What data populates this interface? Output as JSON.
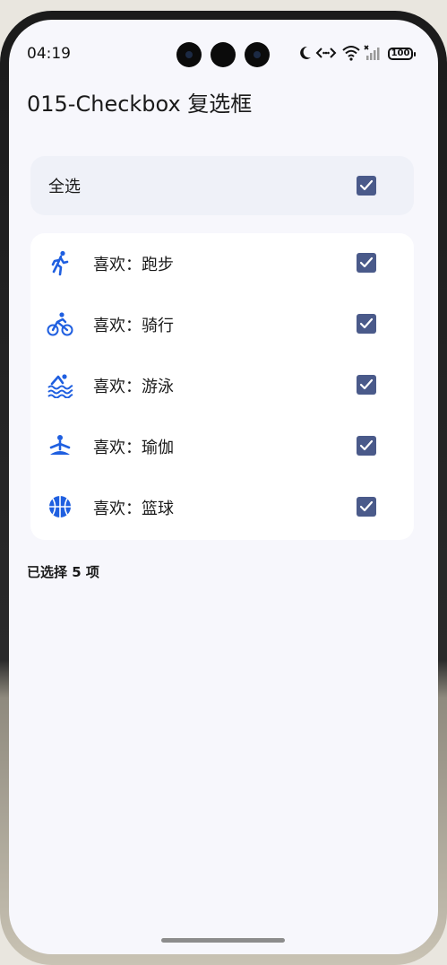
{
  "status_bar": {
    "time": "04:19",
    "battery": "100"
  },
  "page": {
    "title": "015-Checkbox 复选框"
  },
  "select_all": {
    "label": "全选",
    "checked": true
  },
  "items": [
    {
      "label": "喜欢：跑步",
      "icon": "running-icon",
      "checked": true
    },
    {
      "label": "喜欢：骑行",
      "icon": "cycling-icon",
      "checked": true
    },
    {
      "label": "喜欢：游泳",
      "icon": "swimming-icon",
      "checked": true
    },
    {
      "label": "喜欢：瑜伽",
      "icon": "yoga-icon",
      "checked": true
    },
    {
      "label": "喜欢：篮球",
      "icon": "basketball-icon",
      "checked": true
    }
  ],
  "summary": {
    "text": "已选择 5 项"
  },
  "colors": {
    "accent": "#4a5a8a",
    "icon_blue": "#1f5fe0",
    "background": "#f7f7fc"
  }
}
